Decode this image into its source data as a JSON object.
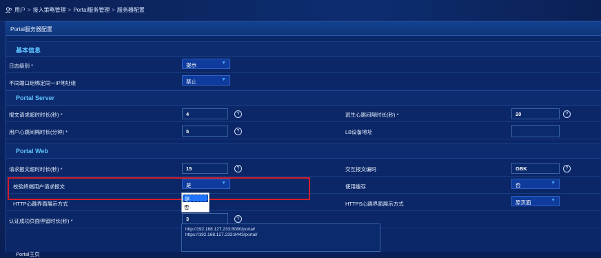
{
  "breadcrumb": {
    "items": [
      "用户",
      "接入策略管理",
      "Portal服务管理",
      "服务器配置"
    ],
    "separator": ">"
  },
  "panel": {
    "title": "Portal服务器配置"
  },
  "sections": {
    "basic": "基本信息",
    "server": "Portal Server",
    "web": "Portal Web"
  },
  "basic": {
    "log_level": {
      "label": "日志级别 *",
      "value": "提示"
    },
    "same_ip": {
      "label": "不同端口组绑定同一IP地址组",
      "value": "禁止"
    }
  },
  "server": {
    "req_timeout": {
      "label": "报文请求超时时长(秒) *",
      "value": "4"
    },
    "heartbeat_interval": {
      "label": "逃生心跳间隔时长(秒) *",
      "value": "20"
    },
    "user_heartbeat": {
      "label": "用户心跳间隔时长(分钟) *",
      "value": "5"
    },
    "lb_address": {
      "label": "LB设备地址",
      "value": ""
    }
  },
  "web": {
    "req_timeout": {
      "label": "请求报文超时时长(秒) *",
      "value": "15"
    },
    "encoding": {
      "label": "交互报文编码",
      "value": "GBK"
    },
    "check_terminal": {
      "label": "校验终端用户请求报文",
      "value": "是"
    },
    "use_cache": {
      "label": "使用缓存",
      "value": "否"
    },
    "http_heartbeat": {
      "label": "HTTP心跳界面展示方式"
    },
    "https_heartbeat": {
      "label": "HTTPS心跳界面展示方式",
      "value": "原页面"
    },
    "auth_success_stay": {
      "label": "认证成功页面停留时长(秒) *",
      "value": "3"
    },
    "portal_home": {
      "label": "Portal主页",
      "lines": [
        "http://192.168.127.233:8080/portal/",
        "https://192.168.127.233:8443/portal/"
      ]
    }
  },
  "dropdown": {
    "options": [
      "是",
      "否"
    ],
    "highlighted": "是"
  },
  "icons": {
    "help": "?",
    "arrow": "▼"
  },
  "colors": {
    "highlight_box": "#d11f2a",
    "section_title": "#5fc3ff",
    "selected_option": "#1e74ff"
  }
}
